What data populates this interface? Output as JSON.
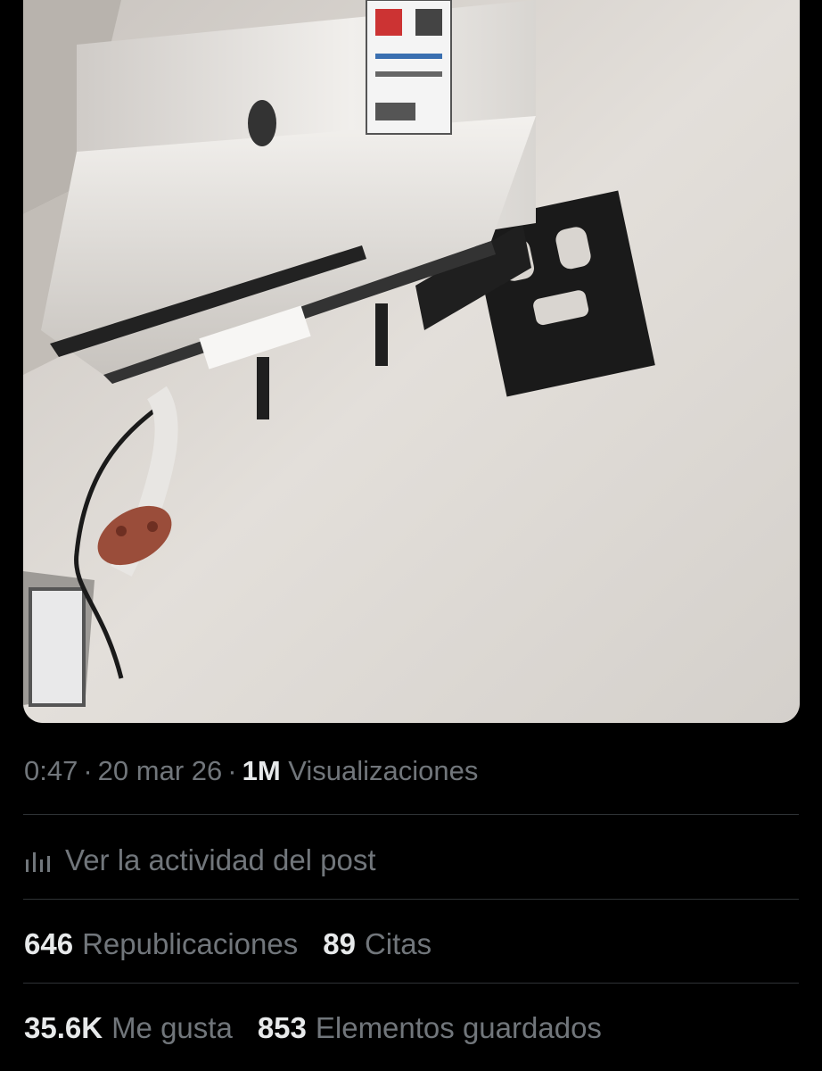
{
  "photo": {
    "subject": "air-conditioner-and-tv-wall-mount"
  },
  "meta": {
    "time": "0:47",
    "separator": "·",
    "date": "20 mar 26",
    "views_count": "1M",
    "views_label": "Visualizaciones"
  },
  "activity": {
    "icon": "analytics-icon",
    "label": "Ver la actividad del post"
  },
  "stats_row1": {
    "reposts_count": "646",
    "reposts_label": "Republicaciones",
    "quotes_count": "89",
    "quotes_label": "Citas"
  },
  "stats_row2": {
    "likes_count": "35.6K",
    "likes_label": "Me gusta",
    "bookmarks_count": "853",
    "bookmarks_label": "Elementos guardados"
  },
  "colors": {
    "background": "#000000",
    "primary_text": "#e7e9ea",
    "secondary_text": "#71767b",
    "divider": "#2f3336"
  }
}
